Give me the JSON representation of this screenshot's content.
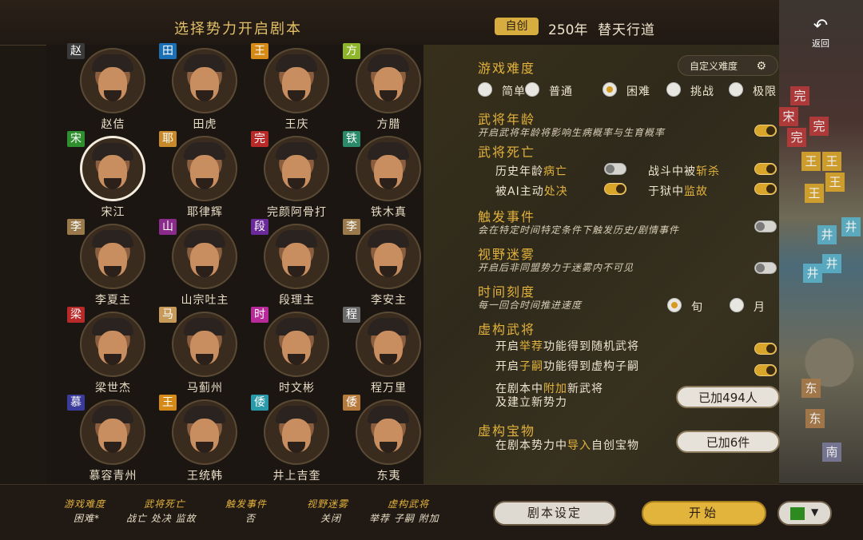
{
  "header": {
    "title": "选择势力开启剧本",
    "custom_badge": "自创",
    "year": "250年",
    "scenario_name": "替天行道"
  },
  "back": {
    "icon": "undo-arrow-icon",
    "label": "返回"
  },
  "generals": [
    {
      "name": "赵佶",
      "badge": "赵",
      "badge_color": "#3a3a3a"
    },
    {
      "name": "田虎",
      "badge": "田",
      "badge_color": "#1b6fb5"
    },
    {
      "name": "王庆",
      "badge": "王",
      "badge_color": "#d58a18"
    },
    {
      "name": "方腊",
      "badge": "方",
      "badge_color": "#8fb52a"
    },
    {
      "name": "宋江",
      "badge": "宋",
      "badge_color": "#2f8f2f",
      "selected": true
    },
    {
      "name": "耶律辉",
      "badge": "耶",
      "badge_color": "#c8892a"
    },
    {
      "name": "完颜阿骨打",
      "badge": "完",
      "badge_color": "#b82a2a"
    },
    {
      "name": "铁木真",
      "badge": "铁",
      "badge_color": "#2a8a6a"
    },
    {
      "name": "李夏主",
      "badge": "李",
      "badge_color": "#9a7a4a"
    },
    {
      "name": "山宗吐主",
      "badge": "山",
      "badge_color": "#8a2a8a"
    },
    {
      "name": "段理主",
      "badge": "段",
      "badge_color": "#6a2a9a"
    },
    {
      "name": "李安主",
      "badge": "李",
      "badge_color": "#9a7a4a"
    },
    {
      "name": "梁世杰",
      "badge": "梁",
      "badge_color": "#b82a2a"
    },
    {
      "name": "马蓟州",
      "badge": "马",
      "badge_color": "#c89a5a"
    },
    {
      "name": "时文彬",
      "badge": "时",
      "badge_color": "#b82a9a"
    },
    {
      "name": "程万里",
      "badge": "程",
      "badge_color": "#6a6a6a"
    },
    {
      "name": "慕容青州",
      "badge": "慕",
      "badge_color": "#3a3a9a"
    },
    {
      "name": "王统韩",
      "badge": "王",
      "badge_color": "#d58a18"
    },
    {
      "name": "井上吉奎",
      "badge": "倭",
      "badge_color": "#2a9aaa"
    },
    {
      "name": "东夷",
      "badge": "倭",
      "badge_color": "#b87a3a"
    }
  ],
  "settings": {
    "difficulty": {
      "title": "游戏难度",
      "custom_button": "自定义难度",
      "options": [
        "简单",
        "普通",
        "困难",
        "挑战",
        "极限"
      ],
      "selected_index": 2
    },
    "general_age": {
      "title": "武将年龄",
      "desc": "开启武将年龄将影响生病概率与生育概率",
      "enabled": true
    },
    "general_death": {
      "title": "武将死亡",
      "historical_prefix": "历史年龄",
      "historical_hl": "病亡",
      "historical_on": false,
      "battle_prefix": "战斗中被",
      "battle_hl": "斩杀",
      "battle_on": true,
      "ai_prefix": "被AI主动",
      "ai_hl": "处决",
      "ai_on": true,
      "prison_prefix": "于狱中",
      "prison_hl": "监故",
      "prison_on": true
    },
    "trigger_events": {
      "title": "触发事件",
      "desc": "会在特定时间特定条件下触发历史/剧情事件",
      "enabled": false
    },
    "fog": {
      "title": "视野迷雾",
      "desc": "开启后非同盟势力于迷雾内不可见",
      "enabled": false
    },
    "time_scale": {
      "title": "时间刻度",
      "desc": "每一回合时间推进速度",
      "options": [
        "旬",
        "月"
      ],
      "selected_index": 0
    },
    "fictional_generals": {
      "title": "虚构武将",
      "recommend_pre": "开启",
      "recommend_hl": "举荐",
      "recommend_post": "功能得到随机武将",
      "recommend_on": true,
      "heir_pre": "开启",
      "heir_hl": "子嗣",
      "heir_post": "功能得到虚构子嗣",
      "heir_on": true,
      "add_pre": "在剧本中",
      "add_hl": "附加",
      "add_post": "新武将",
      "add_line2": "及建立新势力",
      "added_button": "已加494人"
    },
    "fictional_treasures": {
      "title": "虚构宝物",
      "pre": "在剧本势力中",
      "hl": "导入",
      "post": "自创宝物",
      "added_button": "已加6件"
    }
  },
  "summary": [
    {
      "key": "游戏难度",
      "value": "困难*"
    },
    {
      "key": "武将死亡",
      "value": "战亡 处决 监故"
    },
    {
      "key": "触发事件",
      "value": "否"
    },
    {
      "key": "视野迷雾",
      "value": "关闭"
    },
    {
      "key": "虚构武将",
      "value": "举荐 子嗣 附加"
    }
  ],
  "footer": {
    "scenario_settings": "剧本设定",
    "start": "开始",
    "color": "#2c8a1e"
  },
  "map_tiles": [
    {
      "text": "完",
      "color": "#b83a3a"
    },
    {
      "text": "宋",
      "color": "#b83a3a"
    },
    {
      "text": "完",
      "color": "#b83a3a"
    },
    {
      "text": "完",
      "color": "#b83a3a"
    },
    {
      "text": "王",
      "color": "#d9a52a"
    },
    {
      "text": "王",
      "color": "#d9a52a"
    },
    {
      "text": "王",
      "color": "#d9a52a"
    },
    {
      "text": "王",
      "color": "#d9a52a"
    },
    {
      "text": "井",
      "color": "#5ab0c8"
    },
    {
      "text": "井",
      "color": "#5ab0c8"
    },
    {
      "text": "井",
      "color": "#5ab0c8"
    },
    {
      "text": "井",
      "color": "#5ab0c8"
    },
    {
      "text": "东",
      "color": "#a87a4a"
    },
    {
      "text": "东",
      "color": "#a87a4a"
    },
    {
      "text": "南",
      "color": "#7a7a9a"
    }
  ]
}
